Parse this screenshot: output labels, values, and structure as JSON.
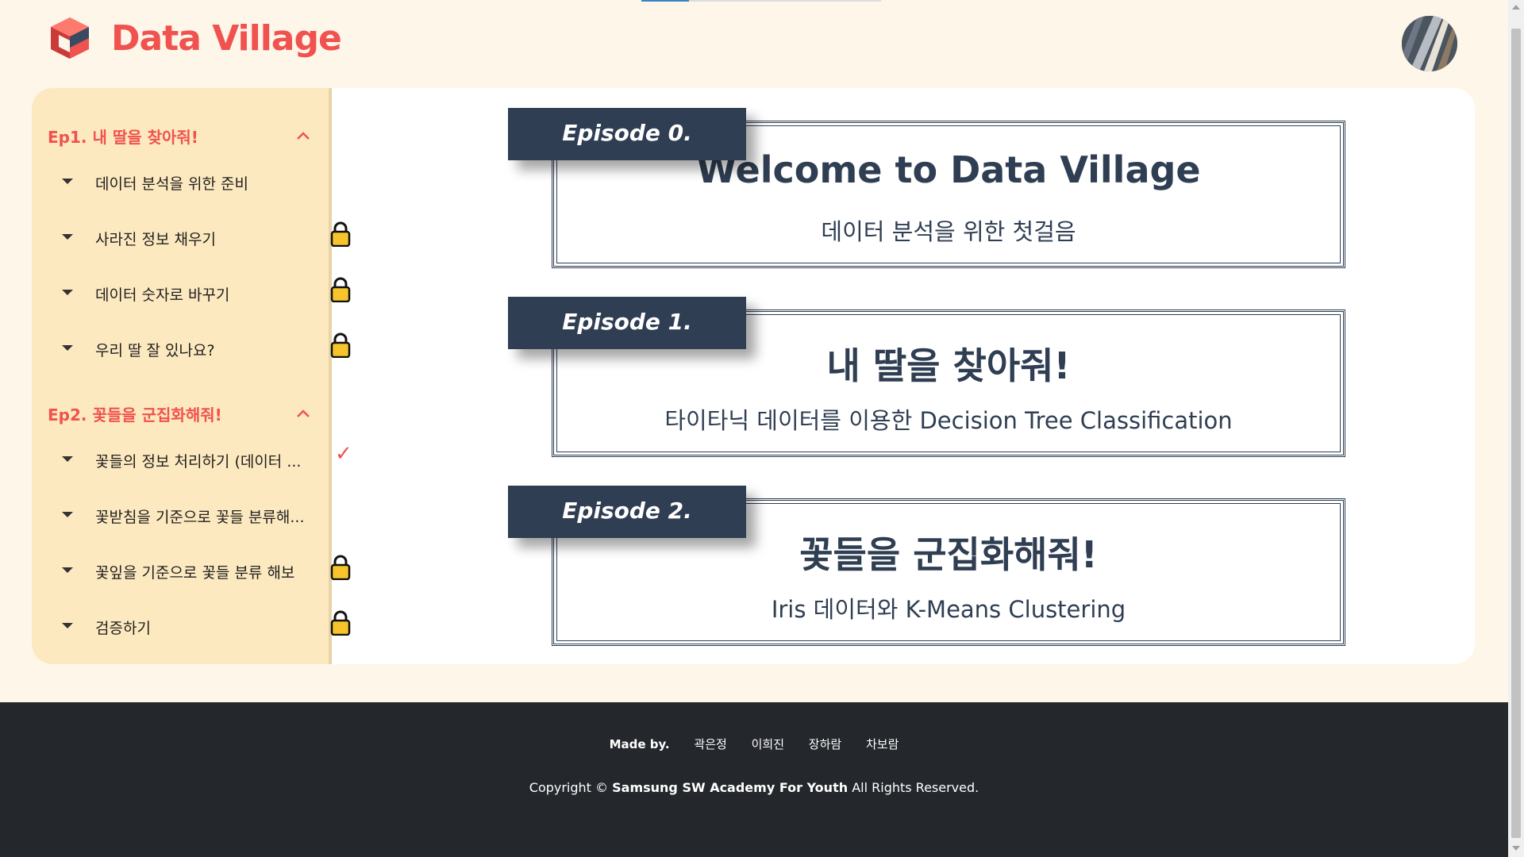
{
  "app": {
    "name": "Data Village",
    "brand_color": "#f0524f",
    "navy": "#2f3e52"
  },
  "sidebar": {
    "episodes": [
      {
        "title": "Ep1. 내 딸을 찾아줘!",
        "items": [
          {
            "label": "데이터 분석을 위한 준비",
            "status": "open"
          },
          {
            "label": "사라진 정보 채우기",
            "status": "locked"
          },
          {
            "label": "데이터 숫자로 바꾸기",
            "status": "locked"
          },
          {
            "label": "우리 딸 잘 있나요?",
            "status": "locked"
          }
        ]
      },
      {
        "title": "Ep2. 꽃들을 군집화해줘!",
        "items": [
          {
            "label": "꽃들의 정보 처리하기 (데이터 ...",
            "status": "done"
          },
          {
            "label": "꽃받침을 기준으로 꽃들 분류해...",
            "status": "open"
          },
          {
            "label": "꽃잎을 기준으로 꽃들 분류 해보",
            "status": "locked"
          },
          {
            "label": "검증하기",
            "status": "locked"
          }
        ]
      }
    ]
  },
  "main": {
    "cards": [
      {
        "tag": "Episode 0.",
        "title": "Welcome to Data Village",
        "subtitle": "데이터 분석을 위한 첫걸음"
      },
      {
        "tag": "Episode 1.",
        "title": "내 딸을 찾아줘!",
        "subtitle": "타이타닉 데이터를 이용한 Decision Tree Classification"
      },
      {
        "tag": "Episode 2.",
        "title": "꽃들을 군집화해줘!",
        "subtitle": "Iris 데이터와 K-Means Clustering"
      }
    ]
  },
  "footer": {
    "made_by_label": "Made by.",
    "authors": [
      "곽은정",
      "이희진",
      "장하람",
      "차보람"
    ],
    "copyright_prefix": "Copyright ©",
    "copyright_org": "Samsung SW Academy For Youth",
    "copyright_suffix": "All Rights Reserved."
  }
}
